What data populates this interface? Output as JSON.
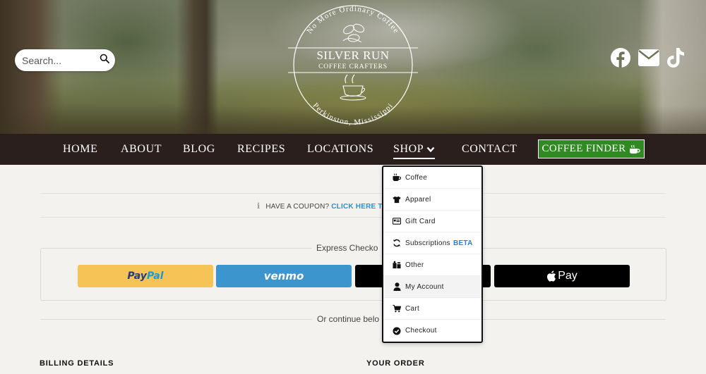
{
  "search": {
    "placeholder": "Search..."
  },
  "logo": {
    "arc_top": "No More Ordinary Coffee",
    "name": "SILVER RUN",
    "tagline": "COFFEE CRAFTERS",
    "arc_bottom": "Perkinston, Mississippi"
  },
  "socials": [
    {
      "icon": "facebook-icon"
    },
    {
      "icon": "mail-icon"
    },
    {
      "icon": "tiktok-icon"
    }
  ],
  "nav": {
    "items": [
      "HOME",
      "ABOUT",
      "BLOG",
      "RECIPES",
      "LOCATIONS",
      "SHOP",
      "CONTACT"
    ],
    "finder": "COFFEE FINDER",
    "finder_color": "#2f8a21",
    "bar_color": "#2a1f1d"
  },
  "dropdown": {
    "items": [
      {
        "label": "Coffee",
        "icon": "coffee-cup-icon"
      },
      {
        "label": "Apparel",
        "icon": "tshirt-icon"
      },
      {
        "label": "Gift Card",
        "icon": "gift-card-icon"
      },
      {
        "label": "Subscriptions",
        "badge": "BETA",
        "icon": "sync-icon"
      },
      {
        "label": "Other",
        "icon": "box-icon"
      },
      {
        "label": "My Account",
        "icon": "user-icon"
      },
      {
        "label": "Cart",
        "icon": "cart-icon"
      },
      {
        "label": "Checkout",
        "icon": "check-circle-icon"
      }
    ]
  },
  "coupon": {
    "prompt": "HAVE A COUPON?",
    "link": "CLICK HERE TO"
  },
  "express": {
    "title": "Express Checko",
    "paypal_1": "Pay",
    "paypal_2": "Pal",
    "venmo": "venmo",
    "apple": "Pay"
  },
  "or_text": "Or continue belo",
  "billing": "BILLING DETAILS",
  "order": "YOUR ORDER"
}
